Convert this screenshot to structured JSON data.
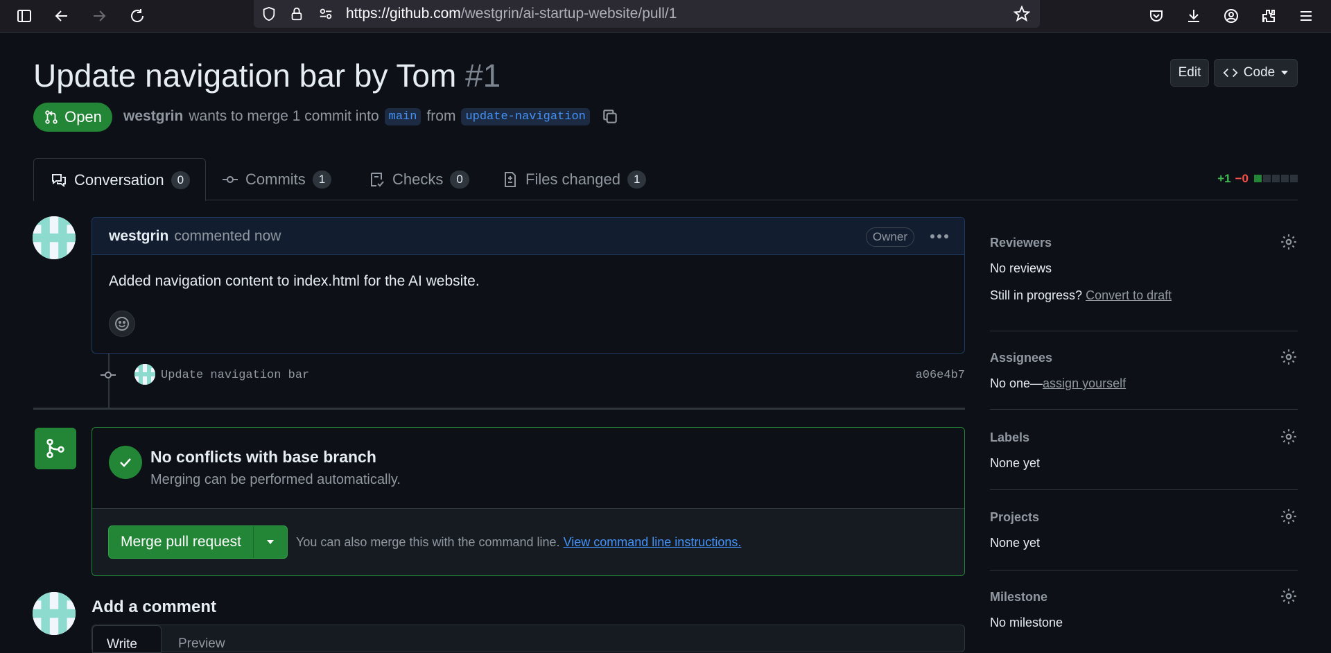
{
  "browser": {
    "url_host": "https://github.com",
    "url_path": "/westgrin/ai-startup-website/pull/1"
  },
  "pr": {
    "title": "Update navigation bar by Tom",
    "number": "#1",
    "edit_label": "Edit",
    "code_label": "Code",
    "state": "Open",
    "author": "westgrin",
    "merge_text": "wants to merge 1 commit into",
    "base_branch": "main",
    "from_text": "from",
    "head_branch": "update-navigation"
  },
  "tabs": [
    {
      "label": "Conversation",
      "count": "0"
    },
    {
      "label": "Commits",
      "count": "1"
    },
    {
      "label": "Checks",
      "count": "0"
    },
    {
      "label": "Files changed",
      "count": "1"
    }
  ],
  "diffstat": {
    "added": "+1",
    "removed": "−0"
  },
  "comment": {
    "author": "westgrin",
    "action": "commented now",
    "badge": "Owner",
    "body": "Added navigation content to index.html for the AI website."
  },
  "commit": {
    "message": "Update navigation bar",
    "sha": "a06e4b7"
  },
  "merge": {
    "title": "No conflicts with base branch",
    "subtitle": "Merging can be performed automatically.",
    "button": "Merge pull request",
    "cmd_text": "You can also merge this with the command line.",
    "cmd_link": "View command line instructions."
  },
  "add_comment": {
    "title": "Add a comment",
    "write_tab": "Write",
    "preview_tab": "Preview"
  },
  "sidebar": {
    "reviewers": {
      "label": "Reviewers",
      "value": "No reviews",
      "draft_prefix": "Still in progress?",
      "draft_link": "Convert to draft"
    },
    "assignees": {
      "label": "Assignees",
      "value": "No one—",
      "link": "assign yourself"
    },
    "labels": {
      "label": "Labels",
      "value": "None yet"
    },
    "projects": {
      "label": "Projects",
      "value": "None yet"
    },
    "milestone": {
      "label": "Milestone",
      "value": "No milestone"
    }
  },
  "colors": {
    "green": "#238636",
    "link": "#4493f8",
    "bg": "#0d1117"
  }
}
